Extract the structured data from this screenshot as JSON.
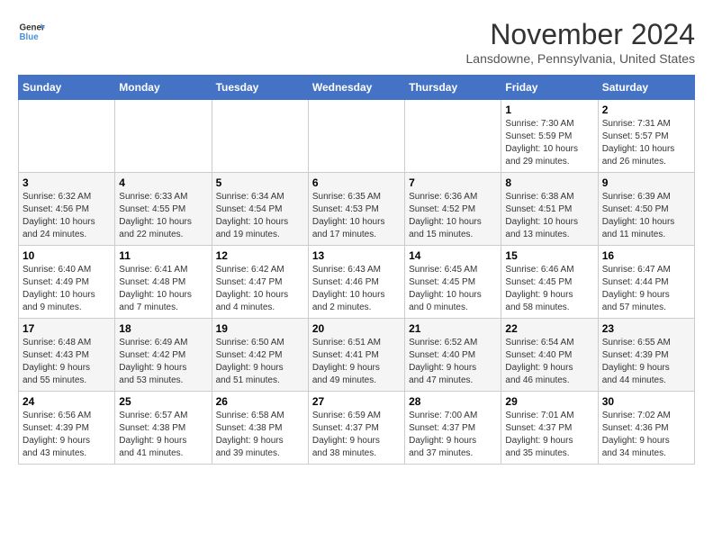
{
  "logo": {
    "line1": "General",
    "line2": "Blue"
  },
  "title": "November 2024",
  "location": "Lansdowne, Pennsylvania, United States",
  "weekdays": [
    "Sunday",
    "Monday",
    "Tuesday",
    "Wednesday",
    "Thursday",
    "Friday",
    "Saturday"
  ],
  "weeks": [
    [
      {
        "day": "",
        "info": ""
      },
      {
        "day": "",
        "info": ""
      },
      {
        "day": "",
        "info": ""
      },
      {
        "day": "",
        "info": ""
      },
      {
        "day": "",
        "info": ""
      },
      {
        "day": "1",
        "info": "Sunrise: 7:30 AM\nSunset: 5:59 PM\nDaylight: 10 hours\nand 29 minutes."
      },
      {
        "day": "2",
        "info": "Sunrise: 7:31 AM\nSunset: 5:57 PM\nDaylight: 10 hours\nand 26 minutes."
      }
    ],
    [
      {
        "day": "3",
        "info": "Sunrise: 6:32 AM\nSunset: 4:56 PM\nDaylight: 10 hours\nand 24 minutes."
      },
      {
        "day": "4",
        "info": "Sunrise: 6:33 AM\nSunset: 4:55 PM\nDaylight: 10 hours\nand 22 minutes."
      },
      {
        "day": "5",
        "info": "Sunrise: 6:34 AM\nSunset: 4:54 PM\nDaylight: 10 hours\nand 19 minutes."
      },
      {
        "day": "6",
        "info": "Sunrise: 6:35 AM\nSunset: 4:53 PM\nDaylight: 10 hours\nand 17 minutes."
      },
      {
        "day": "7",
        "info": "Sunrise: 6:36 AM\nSunset: 4:52 PM\nDaylight: 10 hours\nand 15 minutes."
      },
      {
        "day": "8",
        "info": "Sunrise: 6:38 AM\nSunset: 4:51 PM\nDaylight: 10 hours\nand 13 minutes."
      },
      {
        "day": "9",
        "info": "Sunrise: 6:39 AM\nSunset: 4:50 PM\nDaylight: 10 hours\nand 11 minutes."
      }
    ],
    [
      {
        "day": "10",
        "info": "Sunrise: 6:40 AM\nSunset: 4:49 PM\nDaylight: 10 hours\nand 9 minutes."
      },
      {
        "day": "11",
        "info": "Sunrise: 6:41 AM\nSunset: 4:48 PM\nDaylight: 10 hours\nand 7 minutes."
      },
      {
        "day": "12",
        "info": "Sunrise: 6:42 AM\nSunset: 4:47 PM\nDaylight: 10 hours\nand 4 minutes."
      },
      {
        "day": "13",
        "info": "Sunrise: 6:43 AM\nSunset: 4:46 PM\nDaylight: 10 hours\nand 2 minutes."
      },
      {
        "day": "14",
        "info": "Sunrise: 6:45 AM\nSunset: 4:45 PM\nDaylight: 10 hours\nand 0 minutes."
      },
      {
        "day": "15",
        "info": "Sunrise: 6:46 AM\nSunset: 4:45 PM\nDaylight: 9 hours\nand 58 minutes."
      },
      {
        "day": "16",
        "info": "Sunrise: 6:47 AM\nSunset: 4:44 PM\nDaylight: 9 hours\nand 57 minutes."
      }
    ],
    [
      {
        "day": "17",
        "info": "Sunrise: 6:48 AM\nSunset: 4:43 PM\nDaylight: 9 hours\nand 55 minutes."
      },
      {
        "day": "18",
        "info": "Sunrise: 6:49 AM\nSunset: 4:42 PM\nDaylight: 9 hours\nand 53 minutes."
      },
      {
        "day": "19",
        "info": "Sunrise: 6:50 AM\nSunset: 4:42 PM\nDaylight: 9 hours\nand 51 minutes."
      },
      {
        "day": "20",
        "info": "Sunrise: 6:51 AM\nSunset: 4:41 PM\nDaylight: 9 hours\nand 49 minutes."
      },
      {
        "day": "21",
        "info": "Sunrise: 6:52 AM\nSunset: 4:40 PM\nDaylight: 9 hours\nand 47 minutes."
      },
      {
        "day": "22",
        "info": "Sunrise: 6:54 AM\nSunset: 4:40 PM\nDaylight: 9 hours\nand 46 minutes."
      },
      {
        "day": "23",
        "info": "Sunrise: 6:55 AM\nSunset: 4:39 PM\nDaylight: 9 hours\nand 44 minutes."
      }
    ],
    [
      {
        "day": "24",
        "info": "Sunrise: 6:56 AM\nSunset: 4:39 PM\nDaylight: 9 hours\nand 43 minutes."
      },
      {
        "day": "25",
        "info": "Sunrise: 6:57 AM\nSunset: 4:38 PM\nDaylight: 9 hours\nand 41 minutes."
      },
      {
        "day": "26",
        "info": "Sunrise: 6:58 AM\nSunset: 4:38 PM\nDaylight: 9 hours\nand 39 minutes."
      },
      {
        "day": "27",
        "info": "Sunrise: 6:59 AM\nSunset: 4:37 PM\nDaylight: 9 hours\nand 38 minutes."
      },
      {
        "day": "28",
        "info": "Sunrise: 7:00 AM\nSunset: 4:37 PM\nDaylight: 9 hours\nand 37 minutes."
      },
      {
        "day": "29",
        "info": "Sunrise: 7:01 AM\nSunset: 4:37 PM\nDaylight: 9 hours\nand 35 minutes."
      },
      {
        "day": "30",
        "info": "Sunrise: 7:02 AM\nSunset: 4:36 PM\nDaylight: 9 hours\nand 34 minutes."
      }
    ]
  ]
}
